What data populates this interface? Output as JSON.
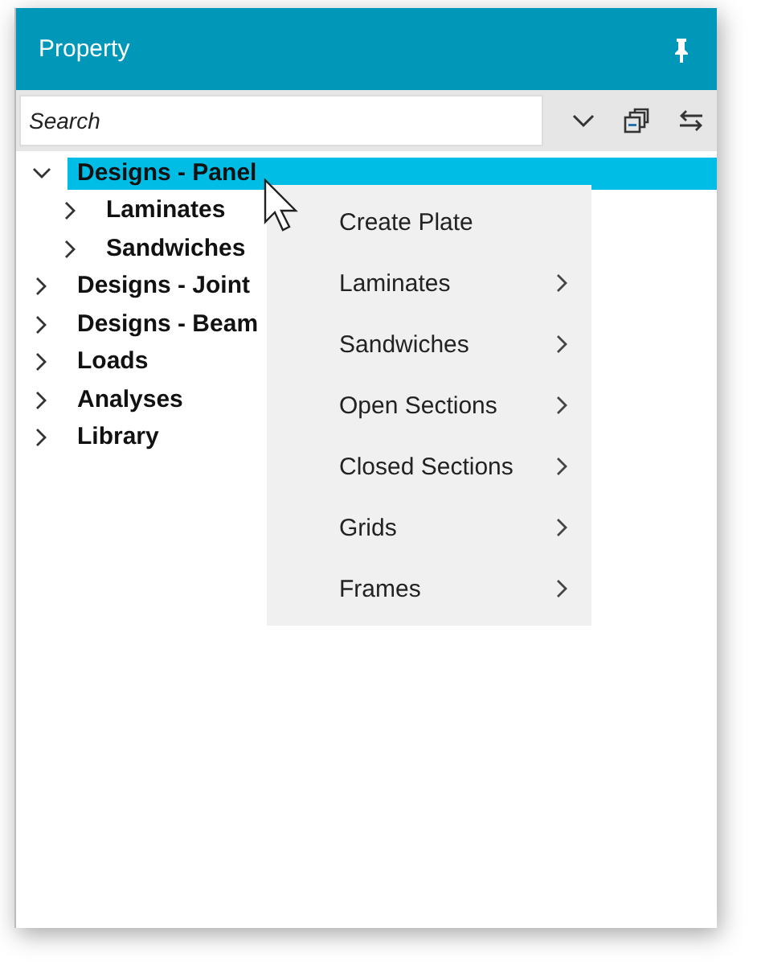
{
  "window": {
    "title": "Property"
  },
  "search": {
    "placeholder": "Search"
  },
  "tree": [
    {
      "label": "Designs - Panel",
      "expanded": true,
      "selected": true,
      "children": [
        {
          "label": "Laminates",
          "expanded": false,
          "selected": false
        },
        {
          "label": "Sandwiches",
          "expanded": false,
          "selected": false
        }
      ]
    },
    {
      "label": "Designs - Joint",
      "expanded": false,
      "selected": false
    },
    {
      "label": "Designs - Beam",
      "expanded": false,
      "selected": false
    },
    {
      "label": "Loads",
      "expanded": false,
      "selected": false
    },
    {
      "label": "Analyses",
      "expanded": false,
      "selected": false
    },
    {
      "label": "Library",
      "expanded": false,
      "selected": false
    }
  ],
  "context_menu": [
    {
      "label": "Create Plate",
      "submenu": false
    },
    {
      "label": "Laminates",
      "submenu": true
    },
    {
      "label": "Sandwiches",
      "submenu": true
    },
    {
      "label": "Open Sections",
      "submenu": true
    },
    {
      "label": "Closed Sections",
      "submenu": true
    },
    {
      "label": "Grids",
      "submenu": true
    },
    {
      "label": "Frames",
      "submenu": true
    }
  ]
}
